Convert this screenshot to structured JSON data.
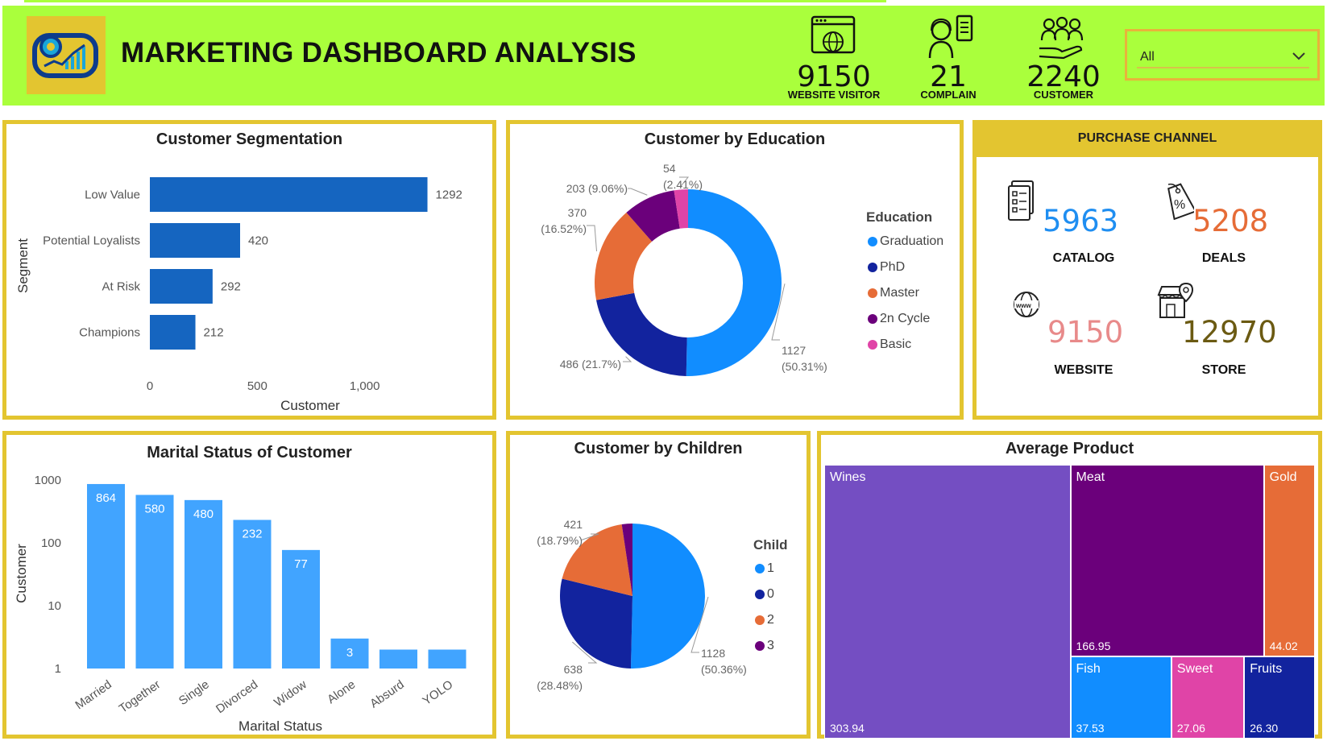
{
  "header": {
    "title": "MARKETING DASHBOARD ANALYSIS",
    "kpis": [
      {
        "value": "9150",
        "label": "WEBSITE VISITOR",
        "icon": "website-icon"
      },
      {
        "value": "21",
        "label": "COMPLAIN",
        "icon": "support-agent-icon"
      },
      {
        "value": "2240",
        "label": "CUSTOMER",
        "icon": "customers-icon"
      }
    ],
    "slicer": {
      "value": "All"
    }
  },
  "segmentation": {
    "title": "Customer Segmentation",
    "chart_data": {
      "type": "bar",
      "orientation": "horizontal",
      "categories": [
        "Low Value",
        "Potential Loyalists",
        "At Risk",
        "Champions"
      ],
      "values": [
        1292,
        420,
        292,
        212
      ],
      "data_labels": [
        "1292",
        "420",
        "292",
        "212"
      ],
      "xlabel": "Customer",
      "ylabel": "Segment",
      "xticks": [
        "0",
        "500",
        "1,000"
      ],
      "xlim": [
        0,
        1350
      ],
      "color": "#1565c0"
    }
  },
  "education": {
    "title": "Customer by Education",
    "legend_title": "Education",
    "chart_data": {
      "type": "pie",
      "variant": "donut",
      "categories": [
        "Graduation",
        "PhD",
        "Master",
        "2n Cycle",
        "Basic"
      ],
      "values": [
        1127,
        486,
        370,
        203,
        54
      ],
      "labels": [
        "1127",
        "486 (21.7%)",
        "370",
        "203 (9.06%)",
        "54"
      ],
      "sublabels": [
        "(50.31%)",
        "",
        "(16.52%)",
        "",
        "(2.41%)"
      ],
      "colors": [
        "#118dff",
        "#12239e",
        "#e66c37",
        "#6b007b",
        "#e044a7"
      ]
    }
  },
  "purchase_channel": {
    "title": "PURCHASE CHANNEL",
    "items": [
      {
        "value": "5963",
        "label": "CATALOG",
        "color": "#1f8ef1",
        "icon": "catalog-icon"
      },
      {
        "value": "5208",
        "label": "DEALS",
        "color": "#e66c37",
        "icon": "discount-tag-icon"
      },
      {
        "value": "9150",
        "label": "WEBSITE",
        "color": "#e88a8a",
        "icon": "www-globe-icon"
      },
      {
        "value": "12970",
        "label": "STORE",
        "color": "#6b5a12",
        "icon": "store-location-icon"
      }
    ]
  },
  "marital": {
    "title": "Marital Status of Customer",
    "chart_data": {
      "type": "bar",
      "scale": "log",
      "categories": [
        "Married",
        "Together",
        "Single",
        "Divorced",
        "Widow",
        "Alone",
        "Absurd",
        "YOLO"
      ],
      "values": [
        864,
        580,
        480,
        232,
        77,
        3,
        2,
        2
      ],
      "data_labels": [
        "864",
        "580",
        "480",
        "232",
        "77",
        "3",
        "",
        ""
      ],
      "xlabel": "Marital Status",
      "ylabel": "Customer",
      "yticks": [
        "1000",
        "100",
        "10",
        "1"
      ],
      "color": "#41a4ff"
    }
  },
  "children": {
    "title": "Customer by Children",
    "legend_title": "Child",
    "chart_data": {
      "type": "pie",
      "categories": [
        "1",
        "0",
        "2",
        "3"
      ],
      "values": [
        1128,
        638,
        421,
        53
      ],
      "labels": [
        "1128",
        "638",
        "421",
        ""
      ],
      "sublabels": [
        "(50.36%)",
        "(28.48%)",
        "(18.79%)",
        ""
      ],
      "colors": [
        "#118dff",
        "#12239e",
        "#e66c37",
        "#6b007b"
      ]
    }
  },
  "avg_product": {
    "title": "Average Product",
    "chart_data": {
      "type": "treemap",
      "categories": [
        "Wines",
        "Meat",
        "Gold",
        "Fish",
        "Sweet",
        "Fruits"
      ],
      "values": [
        303.94,
        166.95,
        44.02,
        37.53,
        27.06,
        26.3
      ],
      "labels": [
        "303.94",
        "166.95",
        "44.02",
        "37.53",
        "27.06",
        "26.30"
      ],
      "colors": [
        "#744ec2",
        "#6b007b",
        "#e66c37",
        "#118dff",
        "#e044a7",
        "#12239e"
      ]
    }
  }
}
